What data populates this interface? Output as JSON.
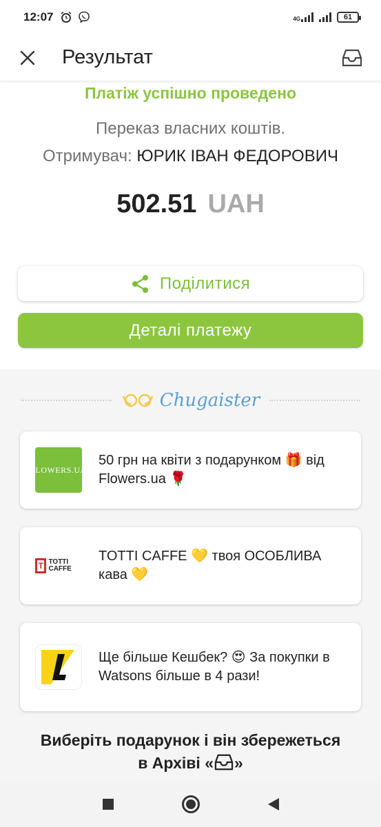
{
  "status_bar": {
    "time": "12:07",
    "network": "4G",
    "battery": "61"
  },
  "header": {
    "title": "Результат",
    "close_icon": "close-icon",
    "archive_icon": "inbox-icon"
  },
  "result": {
    "success_message": "Платіж успішно проведено",
    "transfer_type": "Переказ власних коштів.",
    "recipient_label": "Отримувач:",
    "recipient_name": "ЮРИК ІВАН ФЕДОРОВИЧ",
    "amount": "502.51",
    "currency": "UAH"
  },
  "actions": {
    "share_label": "Поділитися",
    "details_label": "Деталі платежу"
  },
  "offers": {
    "brand": "Chugaister",
    "items": [
      {
        "logo_text": "FLOWERS.UA",
        "text": "50 грн на квіти з подарунком 🎁 від Flowers.ua 🌹"
      },
      {
        "logo_text": "TOTTI CAFFE",
        "text": "TOTTI CAFFE 💛 твоя ОСОБЛИВА кава 💛"
      },
      {
        "logo_text": "",
        "text": "Ще більше Кешбек? 😍 За покупки в Watsons більше в 4 рази!"
      }
    ],
    "cta_line1": "Виберіть подарунок і він збережеться",
    "cta_line2_prefix": "в Архіві «",
    "cta_line2_suffix": "»"
  },
  "colors": {
    "accent_green": "#8cc63f",
    "text_dark": "#222222",
    "text_gray": "#707070",
    "chugaister_blue": "#5c9fd6"
  }
}
